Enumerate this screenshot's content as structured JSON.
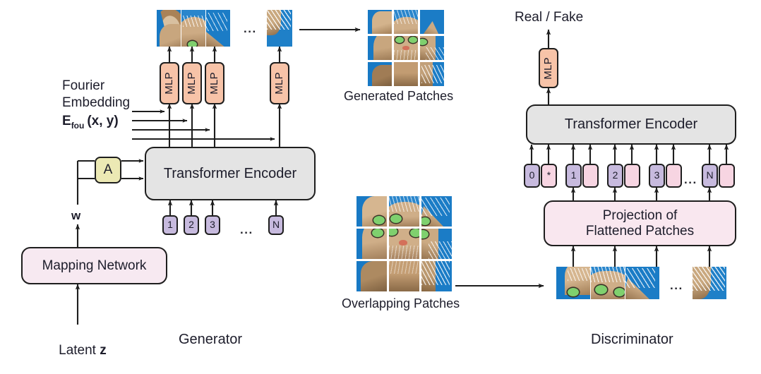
{
  "figure": {
    "generator_caption": "Generator",
    "discriminator_caption": "Discriminator"
  },
  "generator": {
    "fourier": {
      "line1": "Fourier",
      "line2": "Embedding",
      "symbol_base": "E",
      "symbol_sub": "fou",
      "symbol_args": "(x, y)"
    },
    "mlp_label": "MLP",
    "mlp_count": 4,
    "encoder_label": "Transformer Encoder",
    "style_box_label": "A",
    "w_label": "w",
    "mapping_network_label": "Mapping  Network",
    "latent_label": "Latent z",
    "latent_prefix": "Latent ",
    "latent_symbol": "z",
    "tokens": [
      "1",
      "2",
      "3",
      "N"
    ],
    "token_ellipsis": "...",
    "top_ellipsis": "...",
    "mid_ellipsis": "...",
    "generated_patches_label": "Generated Patches",
    "output_patch_count": 4
  },
  "discriminator": {
    "output_label": "Real / Fake",
    "mlp_label": "MLP",
    "encoder_label": "Transformer Encoder",
    "projection_line1": "Projection of",
    "projection_line2": "Flattened Patches",
    "tokens": [
      {
        "pos": "0",
        "patch": "*"
      },
      {
        "pos": "1",
        "patch": ""
      },
      {
        "pos": "2",
        "patch": ""
      },
      {
        "pos": "3",
        "patch": ""
      },
      {
        "pos": "N",
        "patch": ""
      }
    ],
    "token_ellipsis": "...",
    "patch_ellipsis": "...",
    "overlapping_patches_label": "Overlapping Patches",
    "input_patch_count": 4
  },
  "colors": {
    "encoder": "#e4e4e4",
    "mlp": "#f7c3a8",
    "token_pos": "#c7bade",
    "token_patch": "#f7d5e2",
    "style_box": "#ece9b4",
    "mapping_network": "#f7e9f1",
    "projection": "#f9e7ef",
    "stroke": "#1e1e1e",
    "text": "#1d1d2b",
    "patch_sky": "#1879c4",
    "patch_fur": "#b5936a",
    "patch_eye": "#8fd67f"
  }
}
